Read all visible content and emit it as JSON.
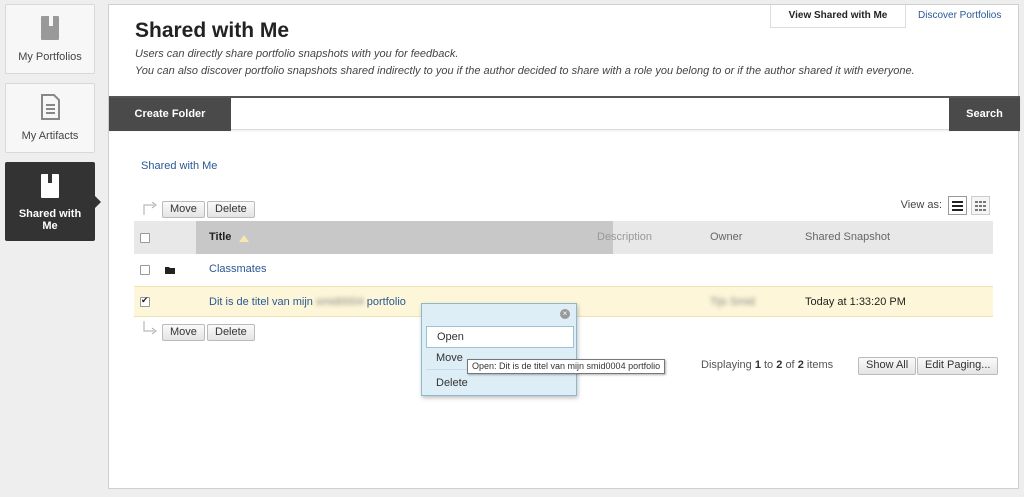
{
  "sidebar": {
    "items": [
      {
        "label": "My Portfolios",
        "icon": "portfolio-book-icon"
      },
      {
        "label": "My Artifacts",
        "icon": "document-icon"
      },
      {
        "label": "Shared with Me",
        "icon": "shared-book-icon",
        "active": true
      }
    ]
  },
  "header": {
    "title": "Shared with Me",
    "description_line1": "Users can directly share portfolio snapshots with you for feedback.",
    "description_line2": "You can also discover portfolio snapshots shared indirectly to you if the author decided to share with a role you belong to or if the author shared it with everyone.",
    "tabs": [
      {
        "label": "View Shared with Me",
        "active": true
      },
      {
        "label": "Discover Portfolios",
        "active": false
      }
    ]
  },
  "action_bar": {
    "create_folder": "Create Folder",
    "search": "Search"
  },
  "breadcrumb": "Shared with Me",
  "toolbar": {
    "move": "Move",
    "delete": "Delete",
    "view_as": "View as:"
  },
  "table": {
    "columns": [
      "Title",
      "Description",
      "Owner",
      "Shared Snapshot"
    ],
    "rows": [
      {
        "type": "folder",
        "title": "Classmates",
        "checked": false
      },
      {
        "type": "item",
        "title_start": "Dit is de titel van mijn",
        "title_blurred": "smid0004",
        "title_end": "portfolio",
        "owner": "Tijs Smid",
        "shared": "Today at 1:33:20 PM",
        "checked": true
      }
    ]
  },
  "paging": {
    "text_prefix": "Displaying",
    "from": "1",
    "to_word": "to",
    "to": "2",
    "of_word": "of",
    "total": "2",
    "suffix": "items",
    "show_all": "Show All",
    "edit_paging": "Edit Paging..."
  },
  "context_menu": {
    "items": [
      "Open",
      "Move",
      "Delete"
    ],
    "tooltip": "Open: Dit is de titel van mijn smid0004 portfolio"
  },
  "colors": {
    "link": "#2a5894",
    "dark_button": "#4a4a4a",
    "selected_row": "#fdf6d8",
    "menu_bg": "#ddeef6"
  }
}
